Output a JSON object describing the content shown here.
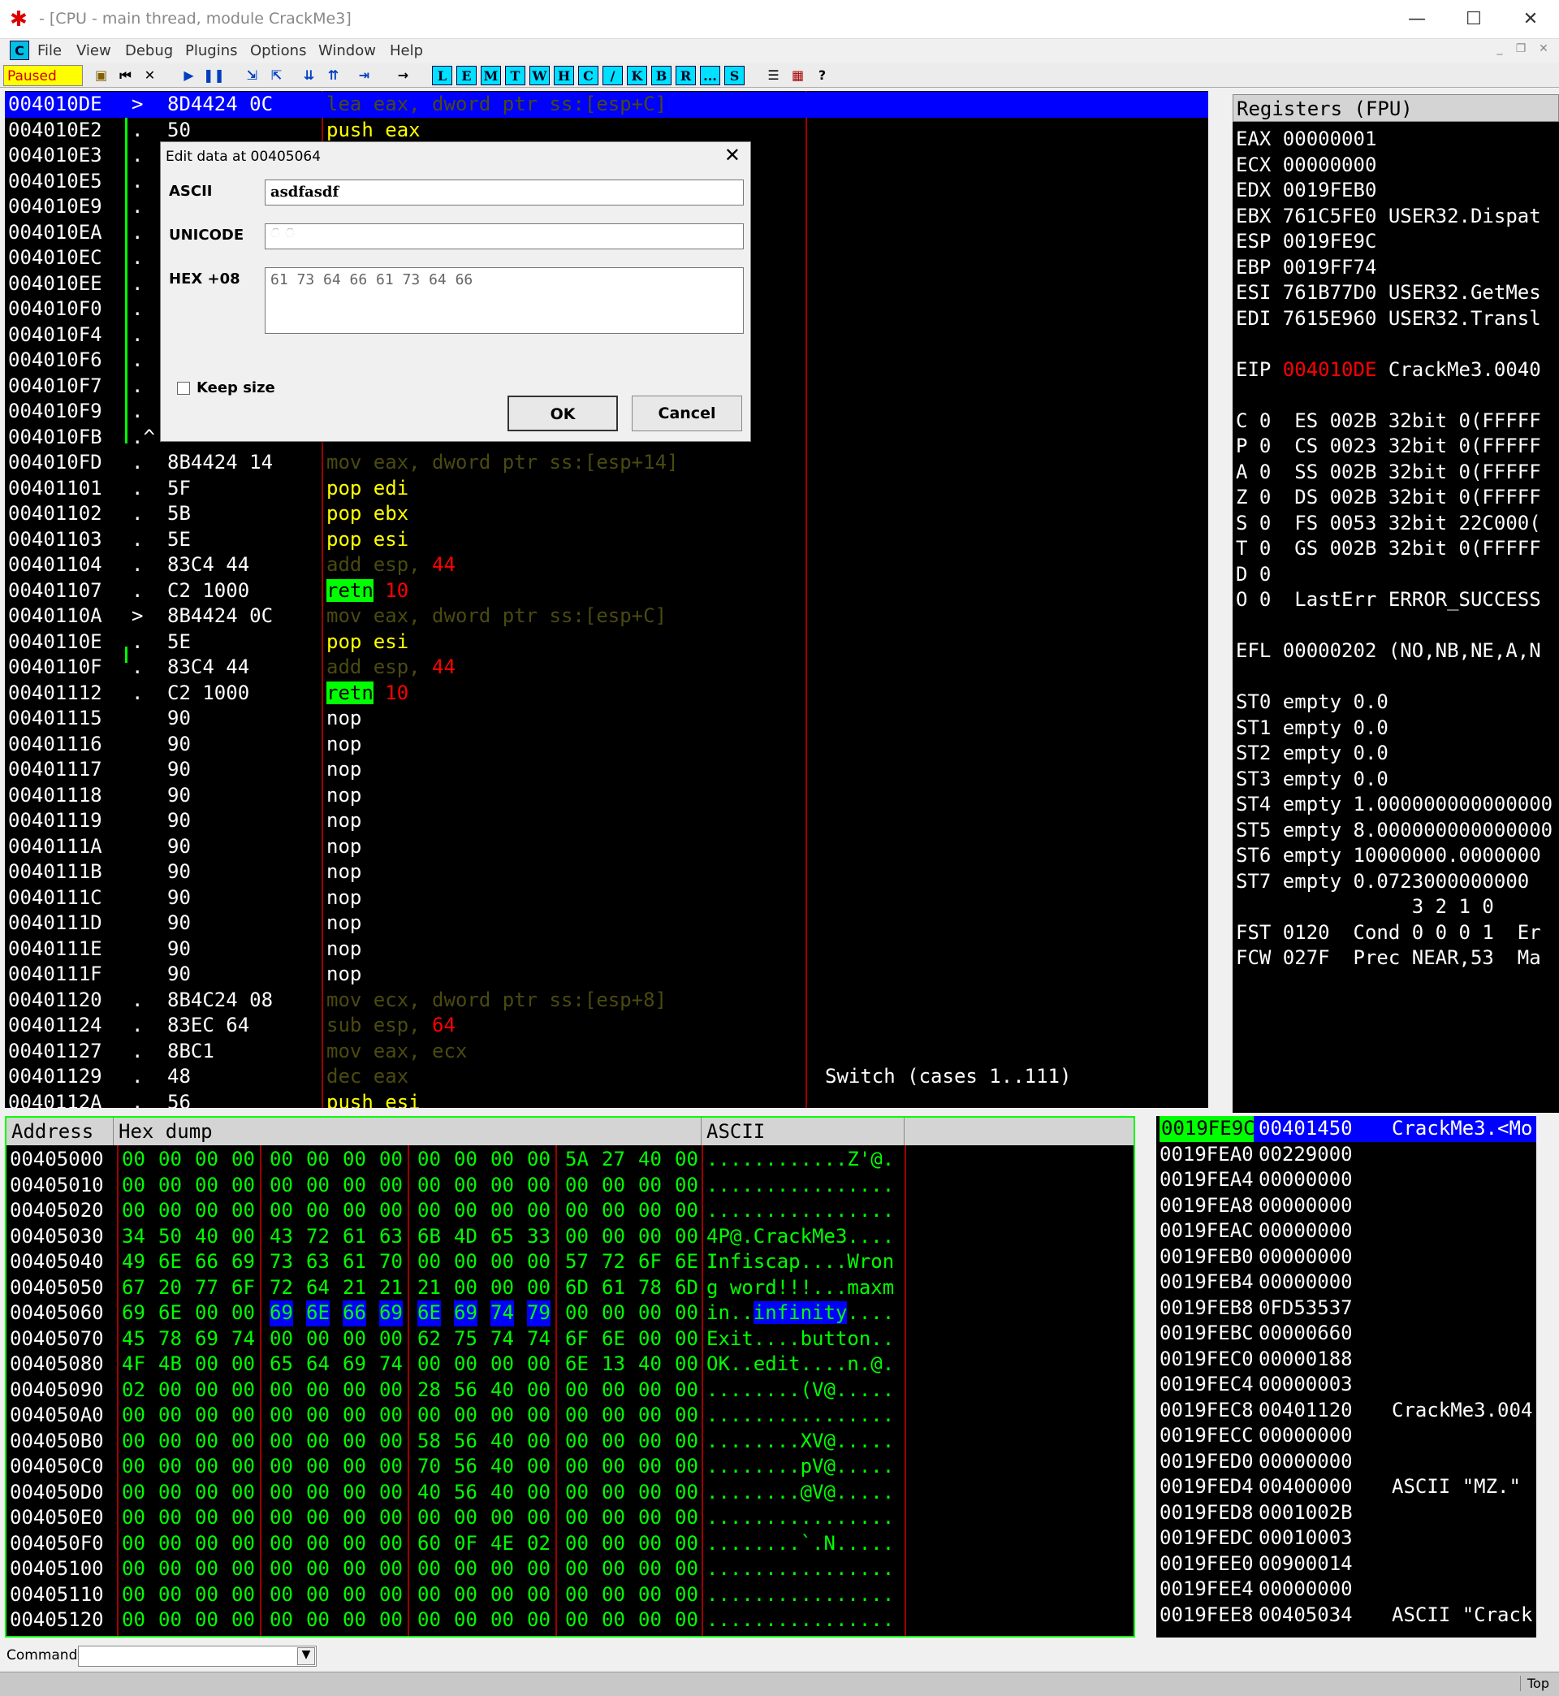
{
  "window": {
    "title": "- [CPU - main thread, module CrackMe3]"
  },
  "menu": [
    "File",
    "View",
    "Debug",
    "Plugins",
    "Options",
    "Window",
    "Help"
  ],
  "toolbar": {
    "status": "Paused",
    "letters": [
      "L",
      "E",
      "M",
      "T",
      "W",
      "H",
      "C",
      "/",
      "K",
      "B",
      "R",
      "...",
      "S"
    ]
  },
  "disasm": [
    {
      "addr": "004010DE",
      "mark": ">",
      "hex": "8D4424 0C",
      "dis": "lea eax, dword ptr ss:[esp+C]",
      "cls": "op-lea",
      "sel": true
    },
    {
      "addr": "004010E2",
      "mark": ".",
      "hex": "50",
      "dis": "push eax",
      "cls": "op-push"
    },
    {
      "addr": "004010E3",
      "mark": ".",
      "hex": "",
      "dis": "",
      "cls": ""
    },
    {
      "addr": "004010E5",
      "mark": ".",
      "hex": "",
      "dis": "",
      "cls": ""
    },
    {
      "addr": "004010E9",
      "mark": ".",
      "hex": "",
      "dis": "",
      "cls": ""
    },
    {
      "addr": "004010EA",
      "mark": ".",
      "hex": "",
      "dis": "",
      "cls": ""
    },
    {
      "addr": "004010EC",
      "mark": ".",
      "hex": "",
      "dis": "",
      "cls": ""
    },
    {
      "addr": "004010EE",
      "mark": ".",
      "hex": "",
      "dis": "",
      "cls": ""
    },
    {
      "addr": "004010F0",
      "mark": ".",
      "hex": "",
      "dis": "",
      "cls": ""
    },
    {
      "addr": "004010F4",
      "mark": ".",
      "hex": "",
      "dis": "",
      "cls": ""
    },
    {
      "addr": "004010F6",
      "mark": ".",
      "hex": "",
      "dis": "",
      "cls": ""
    },
    {
      "addr": "004010F7",
      "mark": ".",
      "hex": "",
      "dis": "",
      "cls": ""
    },
    {
      "addr": "004010F9",
      "mark": ".",
      "hex": "",
      "dis": "",
      "cls": ""
    },
    {
      "addr": "004010FB",
      "mark": ".^",
      "hex": "",
      "dis": "",
      "cls": ""
    },
    {
      "addr": "004010FD",
      "mark": ".",
      "hex": "8B4424 14",
      "dis": "mov eax, dword ptr ss:[esp+14]",
      "cls": "op-mov"
    },
    {
      "addr": "00401101",
      "mark": ".",
      "hex": "5F",
      "dis": "pop edi",
      "cls": "op-pop"
    },
    {
      "addr": "00401102",
      "mark": ".",
      "hex": "5B",
      "dis": "pop ebx",
      "cls": "op-pop"
    },
    {
      "addr": "00401103",
      "mark": ".",
      "hex": "5E",
      "dis": "pop esi",
      "cls": "op-pop"
    },
    {
      "addr": "00401104",
      "mark": ".",
      "hex": "83C4 44",
      "dis": "add esp, 44",
      "cls": "op-add"
    },
    {
      "addr": "00401107",
      "mark": ".",
      "hex": "C2 1000",
      "dis": "retn 10",
      "cls": "op-retn"
    },
    {
      "addr": "0040110A",
      "mark": ">",
      "hex": "8B4424 0C",
      "dis": "mov eax, dword ptr ss:[esp+C]",
      "cls": "op-mov"
    },
    {
      "addr": "0040110E",
      "mark": ".",
      "hex": "5E",
      "dis": "pop esi",
      "cls": "op-pop"
    },
    {
      "addr": "0040110F",
      "mark": ".",
      "hex": "83C4 44",
      "dis": "add esp, 44",
      "cls": "op-add"
    },
    {
      "addr": "00401112",
      "mark": ".",
      "hex": "C2 1000",
      "dis": "retn 10",
      "cls": "op-retn"
    },
    {
      "addr": "00401115",
      "mark": "",
      "hex": "90",
      "dis": "nop",
      "cls": "op-nop"
    },
    {
      "addr": "00401116",
      "mark": "",
      "hex": "90",
      "dis": "nop",
      "cls": "op-nop"
    },
    {
      "addr": "00401117",
      "mark": "",
      "hex": "90",
      "dis": "nop",
      "cls": "op-nop"
    },
    {
      "addr": "00401118",
      "mark": "",
      "hex": "90",
      "dis": "nop",
      "cls": "op-nop"
    },
    {
      "addr": "00401119",
      "mark": "",
      "hex": "90",
      "dis": "nop",
      "cls": "op-nop"
    },
    {
      "addr": "0040111A",
      "mark": "",
      "hex": "90",
      "dis": "nop",
      "cls": "op-nop"
    },
    {
      "addr": "0040111B",
      "mark": "",
      "hex": "90",
      "dis": "nop",
      "cls": "op-nop"
    },
    {
      "addr": "0040111C",
      "mark": "",
      "hex": "90",
      "dis": "nop",
      "cls": "op-nop"
    },
    {
      "addr": "0040111D",
      "mark": "",
      "hex": "90",
      "dis": "nop",
      "cls": "op-nop"
    },
    {
      "addr": "0040111E",
      "mark": "",
      "hex": "90",
      "dis": "nop",
      "cls": "op-nop"
    },
    {
      "addr": "0040111F",
      "mark": "",
      "hex": "90",
      "dis": "nop",
      "cls": "op-nop"
    },
    {
      "addr": "00401120",
      "mark": ".",
      "hex": "8B4C24 08",
      "dis": "mov ecx, dword ptr ss:[esp+8]",
      "cls": "op-mov"
    },
    {
      "addr": "00401124",
      "mark": ".",
      "hex": "83EC 64",
      "dis": "sub esp, 64",
      "cls": "op-sub"
    },
    {
      "addr": "00401127",
      "mark": ".",
      "hex": "8BC1",
      "dis": "mov eax, ecx",
      "cls": "op-mov"
    },
    {
      "addr": "00401129",
      "mark": ".",
      "hex": "48",
      "dis": "dec eax",
      "cls": "op-dec",
      "comment": "Switch (cases 1..111)"
    },
    {
      "addr": "0040112A",
      "mark": ".",
      "hex": "56",
      "dis": "push esi",
      "cls": "op-push"
    }
  ],
  "registers": {
    "header": "Registers (FPU)",
    "lines": [
      "EAX 00000001",
      "ECX 00000000",
      "EDX 0019FEB0",
      "EBX 761C5FE0 USER32.Dispat",
      "ESP 0019FE9C",
      "EBP 0019FF74",
      "ESI 761B77D0 USER32.GetMes",
      "EDI 7615E960 USER32.Transl",
      "",
      "EIP 004010DE CrackMe3.0040",
      "",
      "C 0  ES 002B 32bit 0(FFFFF",
      "P 0  CS 0023 32bit 0(FFFFF",
      "A 0  SS 002B 32bit 0(FFFFF",
      "Z 0  DS 002B 32bit 0(FFFFF",
      "S 0  FS 0053 32bit 22C000(",
      "T 0  GS 002B 32bit 0(FFFFF",
      "D 0",
      "O 0  LastErr ERROR_SUCCESS",
      "",
      "EFL 00000202 (NO,NB,NE,A,N",
      "",
      "ST0 empty 0.0",
      "ST1 empty 0.0",
      "ST2 empty 0.0",
      "ST3 empty 0.0",
      "ST4 empty 1.000000000000000",
      "ST5 empty 8.000000000000000",
      "ST6 empty 10000000.0000000",
      "ST7 empty 0.0723000000000",
      "               3 2 1 0",
      "FST 0120  Cond 0 0 0 1  Er",
      "FCW 027F  Prec NEAR,53  Ma"
    ]
  },
  "dump": {
    "headers": [
      "Address",
      "Hex dump",
      "ASCII"
    ],
    "rows": [
      {
        "a": "00405000",
        "h": [
          "00",
          "00",
          "00",
          "00",
          "00",
          "00",
          "00",
          "00",
          "00",
          "00",
          "00",
          "00",
          "5A",
          "27",
          "40",
          "00"
        ],
        "s": "............Z'@."
      },
      {
        "a": "00405010",
        "h": [
          "00",
          "00",
          "00",
          "00",
          "00",
          "00",
          "00",
          "00",
          "00",
          "00",
          "00",
          "00",
          "00",
          "00",
          "00",
          "00"
        ],
        "s": "................"
      },
      {
        "a": "00405020",
        "h": [
          "00",
          "00",
          "00",
          "00",
          "00",
          "00",
          "00",
          "00",
          "00",
          "00",
          "00",
          "00",
          "00",
          "00",
          "00",
          "00"
        ],
        "s": "................"
      },
      {
        "a": "00405030",
        "h": [
          "34",
          "50",
          "40",
          "00",
          "43",
          "72",
          "61",
          "63",
          "6B",
          "4D",
          "65",
          "33",
          "00",
          "00",
          "00",
          "00"
        ],
        "s": "4P@.CrackMe3...."
      },
      {
        "a": "00405040",
        "h": [
          "49",
          "6E",
          "66",
          "69",
          "73",
          "63",
          "61",
          "70",
          "00",
          "00",
          "00",
          "00",
          "57",
          "72",
          "6F",
          "6E"
        ],
        "s": "Infiscap....Wron"
      },
      {
        "a": "00405050",
        "h": [
          "67",
          "20",
          "77",
          "6F",
          "72",
          "64",
          "21",
          "21",
          "21",
          "00",
          "00",
          "00",
          "6D",
          "61",
          "78",
          "6D"
        ],
        "s": "g word!!!...maxm"
      },
      {
        "a": "00405060",
        "h": [
          "69",
          "6E",
          "00",
          "00",
          "69",
          "6E",
          "66",
          "69",
          "6E",
          "69",
          "74",
          "79",
          "00",
          "00",
          "00",
          "00"
        ],
        "s": "in..infinity....",
        "sel": true
      },
      {
        "a": "00405070",
        "h": [
          "45",
          "78",
          "69",
          "74",
          "00",
          "00",
          "00",
          "00",
          "62",
          "75",
          "74",
          "74",
          "6F",
          "6E",
          "00",
          "00"
        ],
        "s": "Exit....button.."
      },
      {
        "a": "00405080",
        "h": [
          "4F",
          "4B",
          "00",
          "00",
          "65",
          "64",
          "69",
          "74",
          "00",
          "00",
          "00",
          "00",
          "6E",
          "13",
          "40",
          "00"
        ],
        "s": "OK..edit....n.@."
      },
      {
        "a": "00405090",
        "h": [
          "02",
          "00",
          "00",
          "00",
          "00",
          "00",
          "00",
          "00",
          "28",
          "56",
          "40",
          "00",
          "00",
          "00",
          "00",
          "00"
        ],
        "s": "........(V@....."
      },
      {
        "a": "004050A0",
        "h": [
          "00",
          "00",
          "00",
          "00",
          "00",
          "00",
          "00",
          "00",
          "00",
          "00",
          "00",
          "00",
          "00",
          "00",
          "00",
          "00"
        ],
        "s": "................"
      },
      {
        "a": "004050B0",
        "h": [
          "00",
          "00",
          "00",
          "00",
          "00",
          "00",
          "00",
          "00",
          "58",
          "56",
          "40",
          "00",
          "00",
          "00",
          "00",
          "00"
        ],
        "s": "........XV@....."
      },
      {
        "a": "004050C0",
        "h": [
          "00",
          "00",
          "00",
          "00",
          "00",
          "00",
          "00",
          "00",
          "70",
          "56",
          "40",
          "00",
          "00",
          "00",
          "00",
          "00"
        ],
        "s": "........pV@....."
      },
      {
        "a": "004050D0",
        "h": [
          "00",
          "00",
          "00",
          "00",
          "00",
          "00",
          "00",
          "00",
          "40",
          "56",
          "40",
          "00",
          "00",
          "00",
          "00",
          "00"
        ],
        "s": "........@V@....."
      },
      {
        "a": "004050E0",
        "h": [
          "00",
          "00",
          "00",
          "00",
          "00",
          "00",
          "00",
          "00",
          "00",
          "00",
          "00",
          "00",
          "00",
          "00",
          "00",
          "00"
        ],
        "s": "................"
      },
      {
        "a": "004050F0",
        "h": [
          "00",
          "00",
          "00",
          "00",
          "00",
          "00",
          "00",
          "00",
          "60",
          "0F",
          "4E",
          "02",
          "00",
          "00",
          "00",
          "00"
        ],
        "s": "........`.N....."
      },
      {
        "a": "00405100",
        "h": [
          "00",
          "00",
          "00",
          "00",
          "00",
          "00",
          "00",
          "00",
          "00",
          "00",
          "00",
          "00",
          "00",
          "00",
          "00",
          "00"
        ],
        "s": "................"
      },
      {
        "a": "00405110",
        "h": [
          "00",
          "00",
          "00",
          "00",
          "00",
          "00",
          "00",
          "00",
          "00",
          "00",
          "00",
          "00",
          "00",
          "00",
          "00",
          "00"
        ],
        "s": "................"
      },
      {
        "a": "00405120",
        "h": [
          "00",
          "00",
          "00",
          "00",
          "00",
          "00",
          "00",
          "00",
          "00",
          "00",
          "00",
          "00",
          "00",
          "00",
          "00",
          "00"
        ],
        "s": "................"
      }
    ]
  },
  "stack": [
    {
      "a": "0019FE9C",
      "v": "00401450",
      "c": "CrackMe3.<Mo",
      "sel": true
    },
    {
      "a": "0019FEA0",
      "v": "00229000",
      "c": ""
    },
    {
      "a": "0019FEA4",
      "v": "00000000",
      "c": ""
    },
    {
      "a": "0019FEA8",
      "v": "00000000",
      "c": ""
    },
    {
      "a": "0019FEAC",
      "v": "00000000",
      "c": ""
    },
    {
      "a": "0019FEB0",
      "v": "00000000",
      "c": ""
    },
    {
      "a": "0019FEB4",
      "v": "00000000",
      "c": ""
    },
    {
      "a": "0019FEB8",
      "v": "0FD53537",
      "c": ""
    },
    {
      "a": "0019FEBC",
      "v": "00000660",
      "c": ""
    },
    {
      "a": "0019FEC0",
      "v": "00000188",
      "c": ""
    },
    {
      "a": "0019FEC4",
      "v": "00000003",
      "c": ""
    },
    {
      "a": "0019FEC8",
      "v": "00401120",
      "c": "CrackMe3.004"
    },
    {
      "a": "0019FECC",
      "v": "00000000",
      "c": ""
    },
    {
      "a": "0019FED0",
      "v": "00000000",
      "c": ""
    },
    {
      "a": "0019FED4",
      "v": "00400000",
      "c": "ASCII \"MZ.\""
    },
    {
      "a": "0019FED8",
      "v": "0001002B",
      "c": ""
    },
    {
      "a": "0019FEDC",
      "v": "00010003",
      "c": ""
    },
    {
      "a": "0019FEE0",
      "v": "00900014",
      "c": ""
    },
    {
      "a": "0019FEE4",
      "v": "00000000",
      "c": ""
    },
    {
      "a": "0019FEE8",
      "v": "00405034",
      "c": "ASCII \"Crack"
    }
  ],
  "command": {
    "label": "Command :",
    "value": ""
  },
  "statusbar": {
    "right": "Top"
  },
  "dialog": {
    "title": "Edit data at 00405064",
    "ascii_label": "ASCII",
    "ascii_value": "asdfasdf",
    "unicode_label": "UNICODE",
    "unicode_value": "ି ି",
    "hex_label": "HEX +08",
    "hex_value": "61 73 64 66 61 73 64 66",
    "keep_size": "Keep size",
    "ok": "OK",
    "cancel": "Cancel"
  }
}
